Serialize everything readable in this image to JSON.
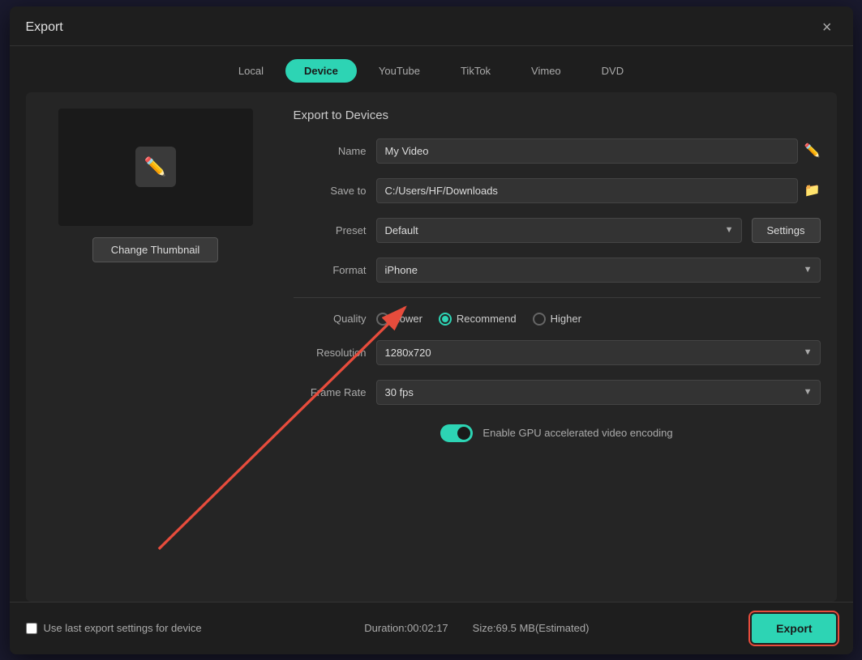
{
  "dialog": {
    "title": "Export",
    "close_label": "×"
  },
  "tabs": [
    {
      "id": "local",
      "label": "Local",
      "active": false
    },
    {
      "id": "device",
      "label": "Device",
      "active": true
    },
    {
      "id": "youtube",
      "label": "YouTube",
      "active": false
    },
    {
      "id": "tiktok",
      "label": "TikTok",
      "active": false
    },
    {
      "id": "vimeo",
      "label": "Vimeo",
      "active": false
    },
    {
      "id": "dvd",
      "label": "DVD",
      "active": false
    }
  ],
  "export_panel": {
    "section_title": "Export to Devices",
    "name_label": "Name",
    "name_value": "My Video",
    "save_to_label": "Save to",
    "save_to_value": "C:/Users/HF/Downloads",
    "preset_label": "Preset",
    "preset_value": "Default",
    "settings_label": "Settings",
    "format_label": "Format",
    "format_value": "iPhone",
    "quality_label": "Quality",
    "quality_lower": "Lower",
    "quality_recommend": "Recommend",
    "quality_higher": "Higher",
    "resolution_label": "Resolution",
    "resolution_value": "1280x720",
    "frame_rate_label": "Frame Rate",
    "frame_rate_value": "30 fps",
    "gpu_label": "Enable GPU accelerated video encoding"
  },
  "thumbnail": {
    "change_label": "Change Thumbnail"
  },
  "footer": {
    "use_last_label": "Use last export settings for device",
    "duration_label": "Duration:00:02:17",
    "size_label": "Size:69.5 MB(Estimated)",
    "export_label": "Export"
  }
}
